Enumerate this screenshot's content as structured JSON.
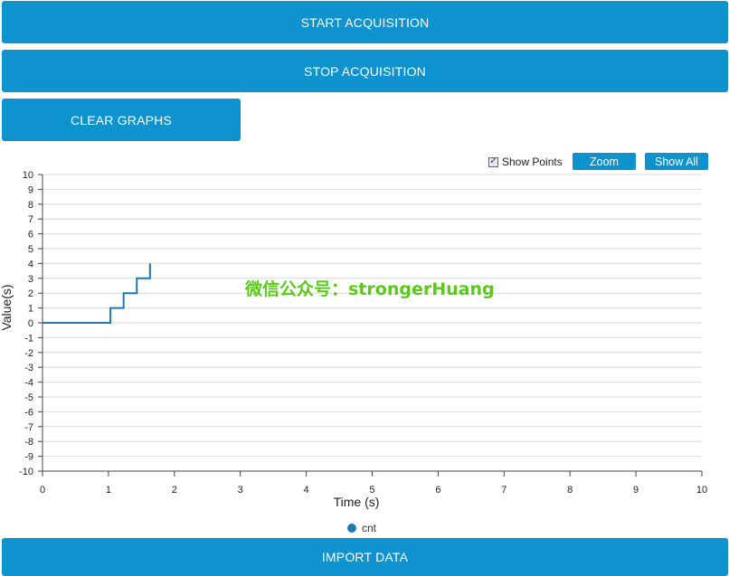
{
  "buttons": {
    "start": "START ACQUISITION",
    "stop": "STOP ACQUISITION",
    "clear": "CLEAR GRAPHS",
    "import": "IMPORT DATA"
  },
  "toolbar": {
    "show_points_label": "Show Points",
    "show_points_checked": true,
    "zoom_label": "Zoom",
    "show_all_label": "Show All"
  },
  "watermark": "微信公众号：strongerHuang",
  "colors": {
    "accent": "#0e93cf",
    "series": "#1f77b4",
    "watermark": "#5cc81a"
  },
  "chart_data": {
    "type": "line",
    "xlabel": "Time (s)",
    "ylabel": "Value(s)",
    "xlim": [
      0,
      10
    ],
    "ylim": [
      -10,
      10
    ],
    "x_ticks": [
      0,
      1,
      2,
      3,
      4,
      5,
      6,
      7,
      8,
      9,
      10
    ],
    "y_ticks": [
      10,
      9,
      8,
      7,
      6,
      5,
      4,
      3,
      2,
      1,
      0,
      -1,
      -2,
      -3,
      -4,
      -5,
      -6,
      -7,
      -8,
      -9,
      -10
    ],
    "grid": true,
    "legend": "bottom-center",
    "series": [
      {
        "name": "cnt",
        "step": true,
        "x": [
          0,
          1.03,
          1.23,
          1.43,
          1.63
        ],
        "values": [
          0,
          1,
          2,
          3,
          4
        ]
      }
    ]
  }
}
